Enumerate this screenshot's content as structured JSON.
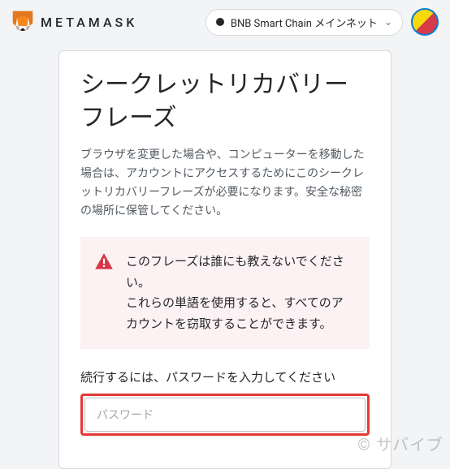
{
  "header": {
    "brand": "METAMASK",
    "network": {
      "label": "BNB Smart Chain メインネット"
    }
  },
  "card": {
    "title": "シークレットリカバリーフレーズ",
    "description": "ブラウザを変更した場合や、コンピューターを移動した場合は、アカウントにアクセスするためにこのシークレットリカバリーフレーズが必要になります。安全な秘密の場所に保管してください。",
    "warning": {
      "line1": "このフレーズは誰にも教えないでください。",
      "line2": "これらの単語を使用すると、すべてのアカウントを窃取することができます。"
    },
    "password": {
      "prompt": "続行するには、パスワードを入力してください",
      "placeholder": "パスワード"
    }
  },
  "watermark": "© サバイブ"
}
